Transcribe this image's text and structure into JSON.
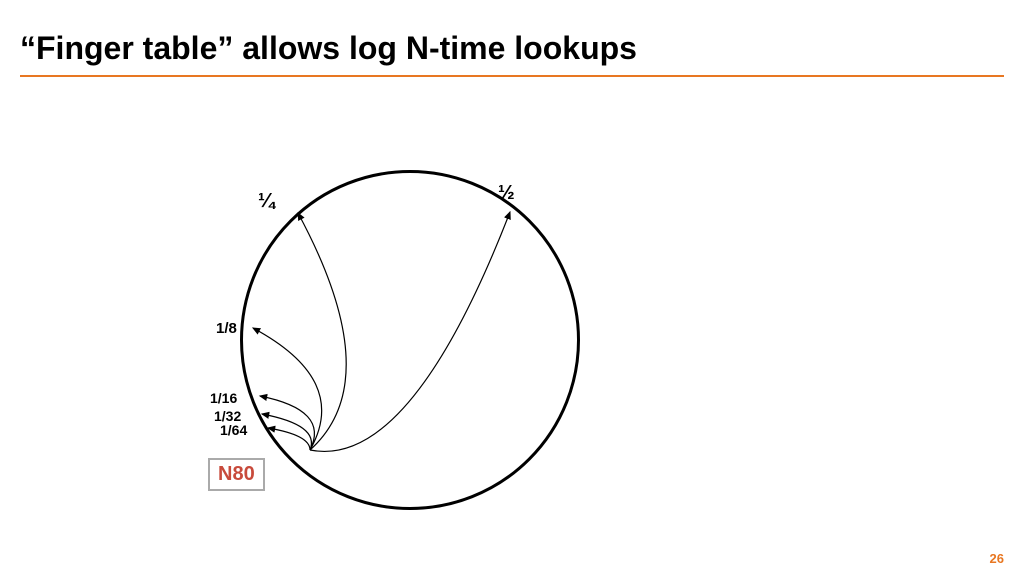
{
  "title": "“Finger table” allows log N-time lookups",
  "page_number": "26",
  "node": {
    "label": "N80"
  },
  "fingers": [
    {
      "fraction_label": "½",
      "css_class": "label-half"
    },
    {
      "fraction_label": "¼",
      "css_class": "label-quarter"
    },
    {
      "fraction_label": "1/8",
      "css_class": "label-eighth"
    },
    {
      "fraction_label": "1/16",
      "css_class": "label-sixteenth small"
    },
    {
      "fraction_label": "1/32",
      "css_class": "label-thirtytwo small"
    },
    {
      "fraction_label": "1/64",
      "css_class": "label-sixtyfour small"
    }
  ],
  "colors": {
    "accent": "#e87722",
    "node_text": "#c84a3b"
  }
}
